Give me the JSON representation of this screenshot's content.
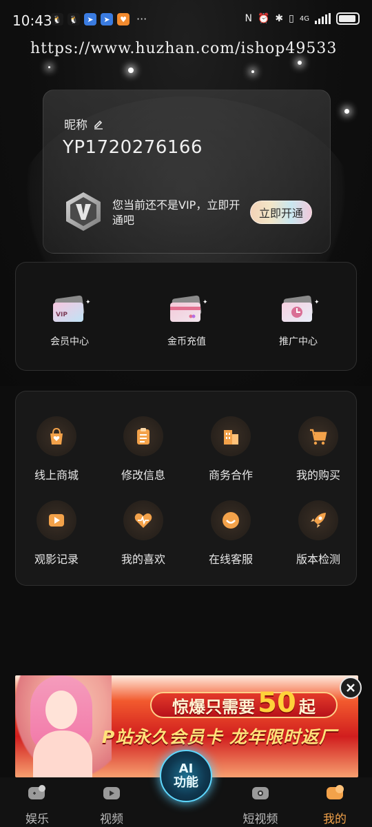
{
  "status_bar": {
    "time": "10:43",
    "more": "···",
    "network": "4G"
  },
  "watermark": "https://www.huzhan.com/ishop49533",
  "profile": {
    "nickname_label": "昵称",
    "user_id": "YP1720276166",
    "vip_prompt": "您当前还不是VIP，立即开通吧",
    "vip_button": "立即开通"
  },
  "quick_actions": [
    {
      "label": "会员中心",
      "icon": "vip-card-icon"
    },
    {
      "label": "金币充值",
      "icon": "coin-card-icon"
    },
    {
      "label": "推广中心",
      "icon": "promo-card-icon"
    }
  ],
  "services": [
    {
      "label": "线上商城",
      "icon": "shopping-bag-icon"
    },
    {
      "label": "修改信息",
      "icon": "clipboard-icon"
    },
    {
      "label": "商务合作",
      "icon": "building-icon"
    },
    {
      "label": "我的购买",
      "icon": "cart-icon"
    },
    {
      "label": "观影记录",
      "icon": "play-icon"
    },
    {
      "label": "我的喜欢",
      "icon": "heart-icon"
    },
    {
      "label": "在线客服",
      "icon": "smile-icon"
    },
    {
      "label": "版本检测",
      "icon": "rocket-icon"
    }
  ],
  "banner": {
    "top_text_1": "惊爆只需要",
    "top_number": "50",
    "top_text_2": "起",
    "bottom_text": "P站永久会员卡 龙年限时返厂"
  },
  "ai_button": {
    "line1": "AI",
    "line2": "功能"
  },
  "bottom_nav": [
    {
      "label": "娱乐",
      "active": false
    },
    {
      "label": "视频",
      "active": false
    },
    {
      "label": "短视频",
      "active": false
    },
    {
      "label": "我的",
      "active": true
    }
  ],
  "colors": {
    "accent": "#f3a24a",
    "background": "#0d0d0d",
    "card": "#181818"
  }
}
